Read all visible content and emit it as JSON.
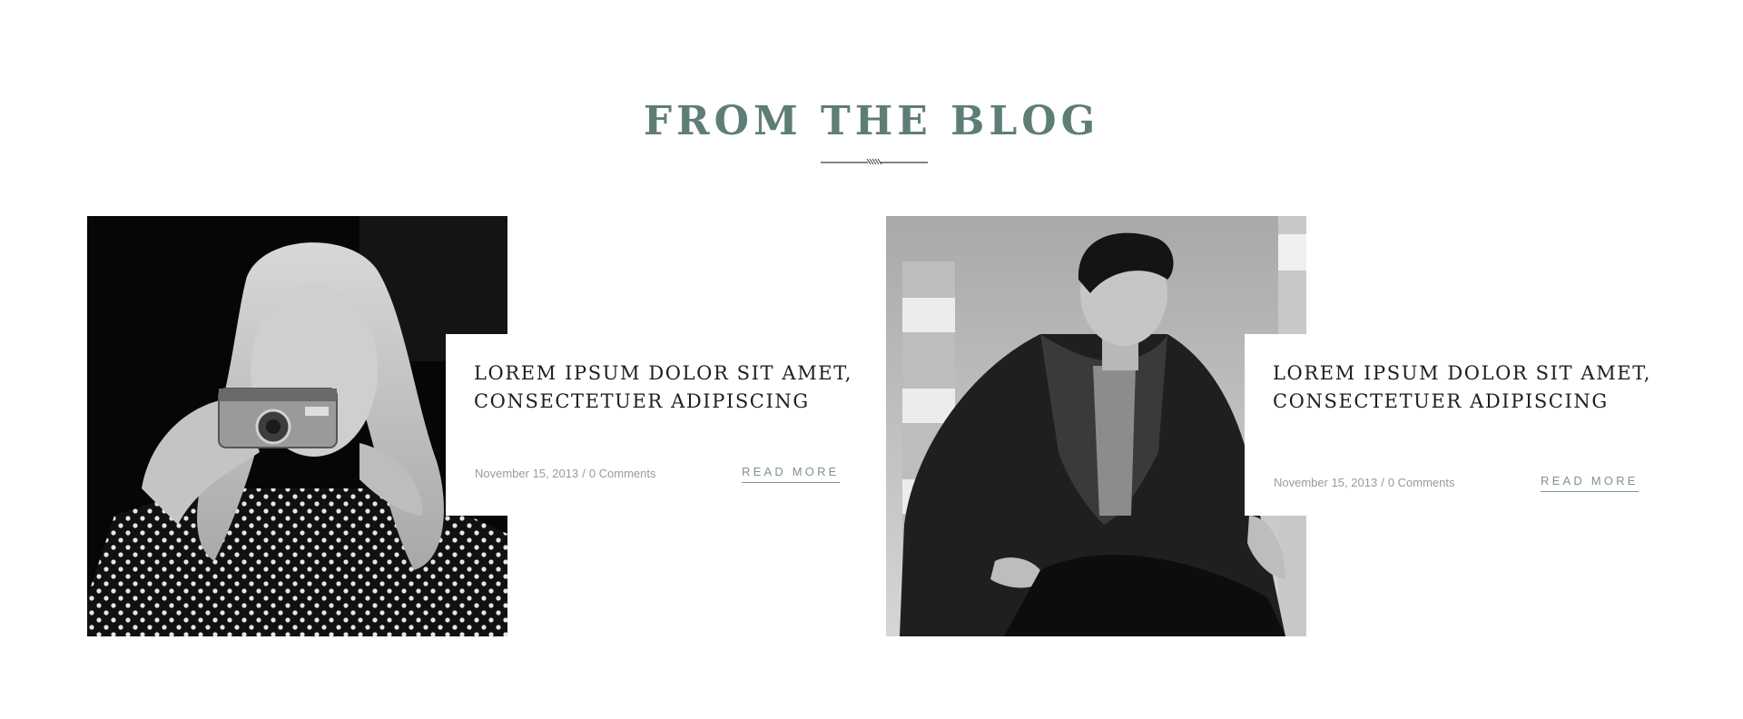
{
  "section": {
    "title": "FROM THE BLOG",
    "accent_color": "#5f7d77",
    "divider_icon": "divider-ornament-icon"
  },
  "posts": [
    {
      "title_line_1": "LOREM IPSUM DOLOR SIT AMET,",
      "title_line_2": "CONSECTETUER ADIPISCING",
      "date": "November 15, 2013",
      "separator": "/",
      "comments": "0 Comments",
      "read_more": "READ MORE",
      "image": "woman-with-camera-photo"
    },
    {
      "title_line_1": "LOREM IPSUM DOLOR SIT AMET,",
      "title_line_2": "CONSECTETUER ADIPISCING",
      "date": "November 15, 2013",
      "separator": "/",
      "comments": "0 Comments",
      "read_more": "READ MORE",
      "image": "man-in-denim-jacket-photo"
    }
  ]
}
